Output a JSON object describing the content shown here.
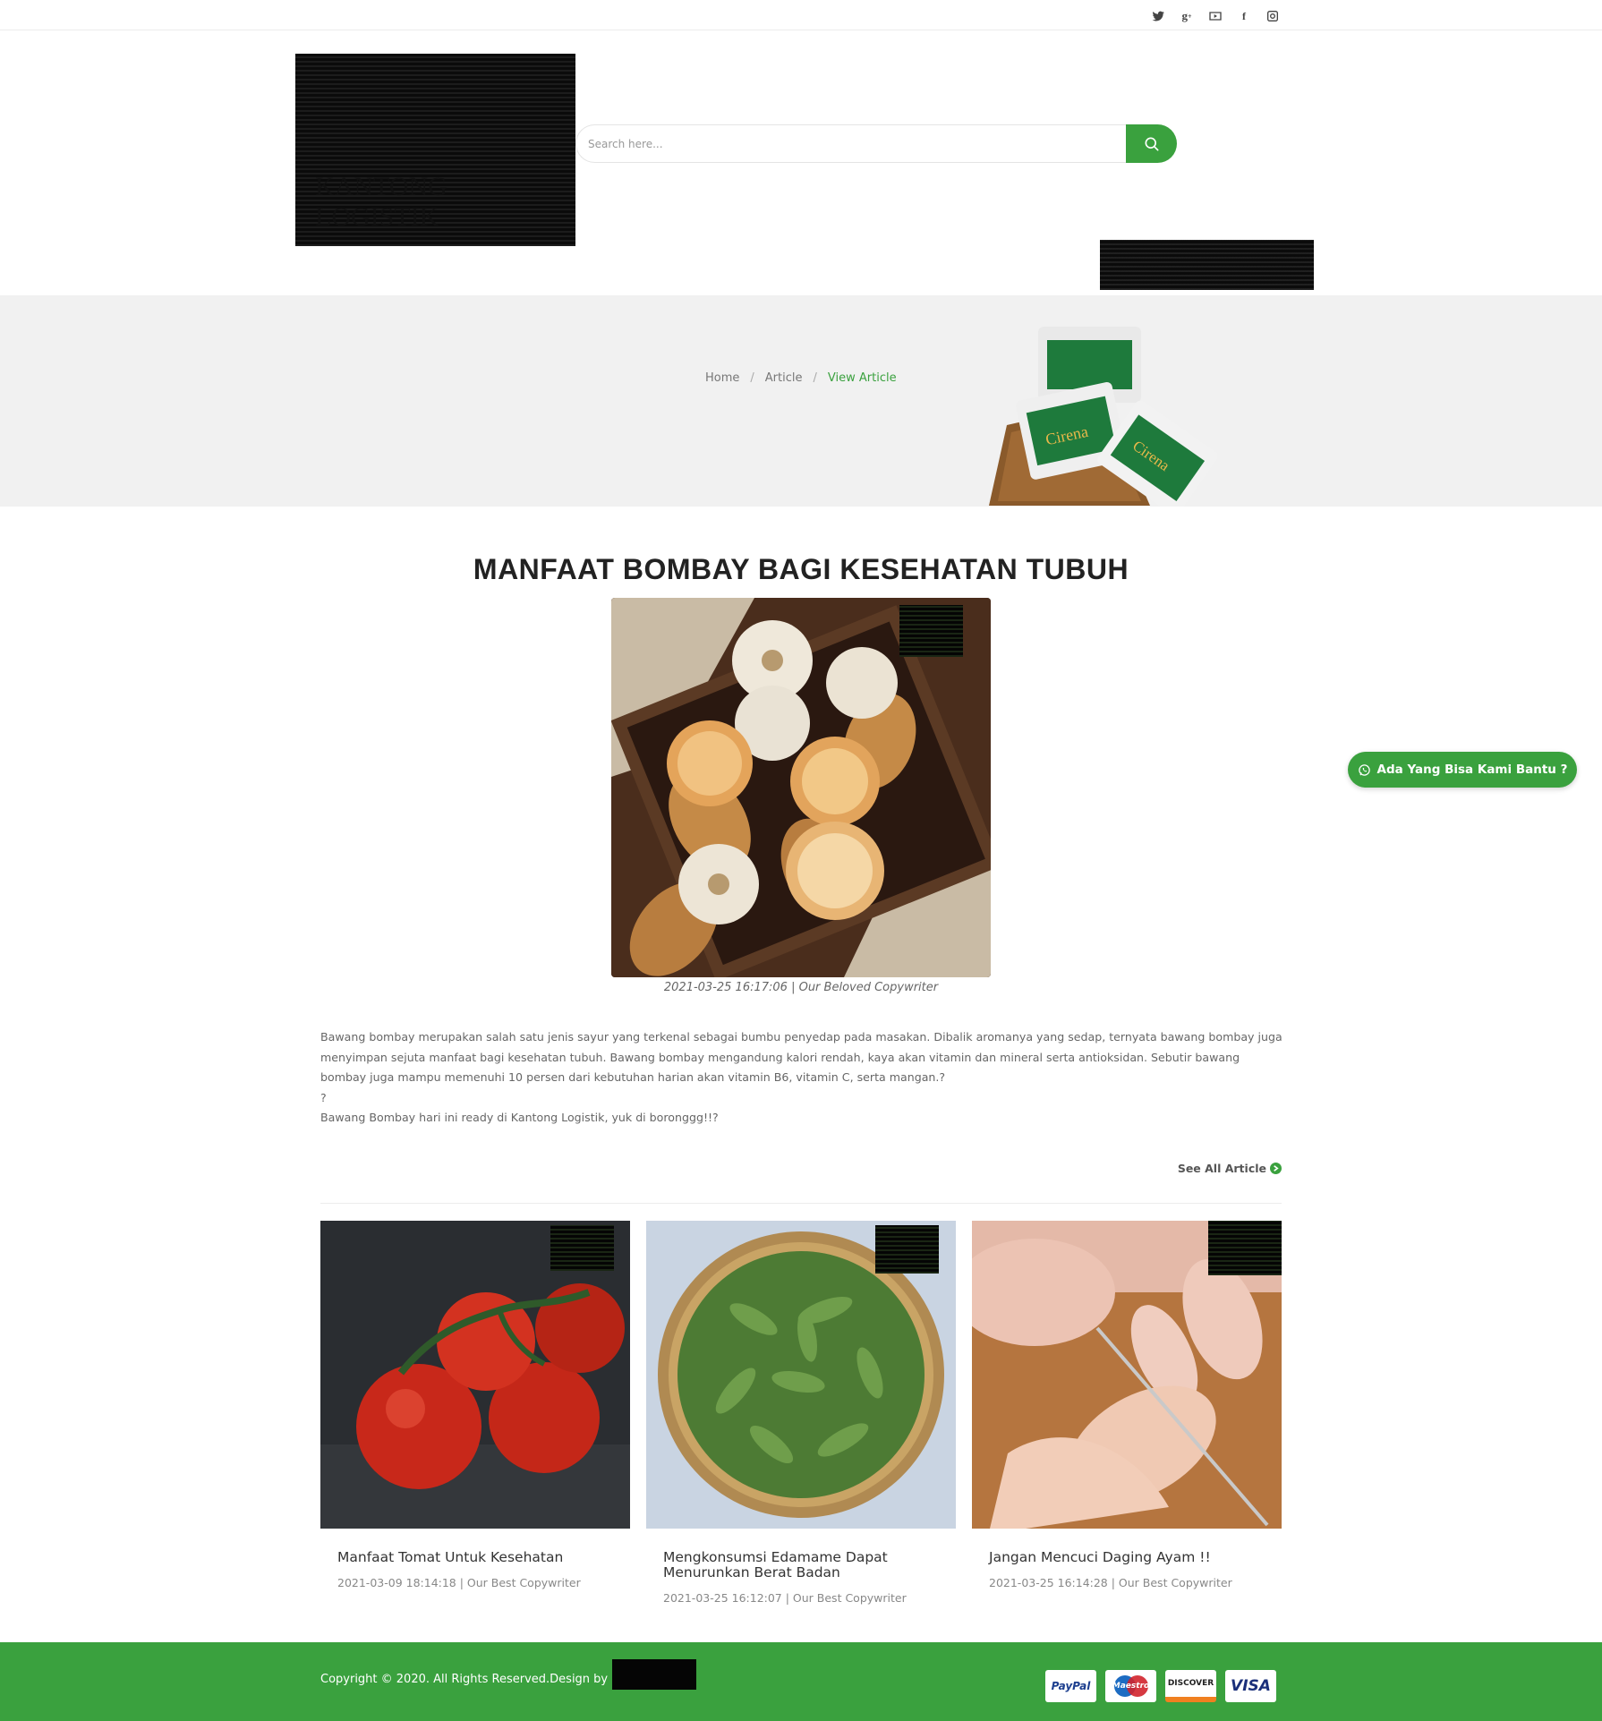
{
  "social": {
    "icons": [
      "twitter-icon",
      "google-plus-icon",
      "youtube-icon",
      "facebook-icon",
      "instagram-icon"
    ]
  },
  "search": {
    "placeholder": "Search here..."
  },
  "breadcrumb": {
    "home": "Home",
    "article": "Article",
    "current": "View Article"
  },
  "article": {
    "title": "MANFAAT BOMBAY BAGI KESEHATAN TUBUH",
    "meta": "2021-03-25 16:17:06 | Our Beloved Copywriter",
    "paragraphs": [
      "Bawang bombay merupakan salah satu jenis sayur yang terkenal sebagai bumbu penyedap pada masakan. Dibalik aromanya yang sedap, ternyata bawang bombay juga menyimpan sejuta manfaat bagi kesehatan tubuh. Bawang bombay mengandung kalori rendah, kaya akan vitamin dan mineral serta antioksidan. Sebutir bawang bombay juga mampu memenuhi 10 persen dari kebutuhan harian akan vitamin B6, vitamin C, serta mangan.?",
      "?",
      "Bawang Bombay hari ini ready di Kantong Logistik, yuk di boronggg!!?"
    ]
  },
  "see_all": "See All Article",
  "related": [
    {
      "title": "Manfaat Tomat Untuk Kesehatan",
      "meta": "2021-03-09 18:14:18 | Our Best Copywriter"
    },
    {
      "title": "Mengkonsumsi Edamame Dapat Menurunkan Berat Badan",
      "meta": "2021-03-25 16:12:07 | Our Best Copywriter"
    },
    {
      "title": "Jangan Mencuci Daging Ayam !!",
      "meta": "2021-03-25 16:14:28 | Our Best Copywriter"
    }
  ],
  "footer": {
    "copyright": "Copyright © 2020. All Rights Reserved.Design by",
    "payments": [
      "PayPal",
      "Maestro",
      "DISCOVER",
      "VISA"
    ]
  },
  "whatsapp": {
    "label": "Ada Yang Bisa Kami Bantu ?"
  },
  "colors": {
    "accent": "#3aa13e"
  }
}
